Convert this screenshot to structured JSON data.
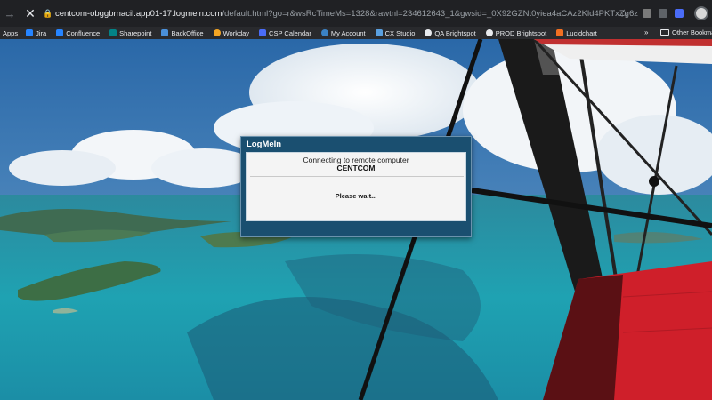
{
  "browser": {
    "url_host": "centcom-obggbrnacil.app01-17.logmein.com",
    "url_path": "/default.html?go=r&wsRcTimeMs=1328&rawtnl=234612643_1&gwsid=_0X92GZNt0yiea4aCAz2Kld4PKTxZg6z",
    "back_icon": "arrow-right-icon",
    "close_icon": "close-icon"
  },
  "bookmarks": {
    "apps_label": "Apps",
    "items": [
      {
        "label": "Jira",
        "color": "#2684ff"
      },
      {
        "label": "Confluence",
        "color": "#2684ff"
      },
      {
        "label": "Sharepoint",
        "color": "#038387"
      },
      {
        "label": "BackOffice",
        "color": "#4a90d9"
      },
      {
        "label": "Workday",
        "color": "#f5a623"
      },
      {
        "label": "CSP Calendar",
        "color": "#4a6cf7"
      },
      {
        "label": "My Account",
        "color": "#3b82c4"
      },
      {
        "label": "CX Studio",
        "color": "#5aa0e0"
      },
      {
        "label": "QA Brightspot",
        "color": "#e8eaed"
      },
      {
        "label": "PROD Brightspot",
        "color": "#e8eaed"
      },
      {
        "label": "Lucidchart",
        "color": "#f26f21"
      }
    ],
    "more_label": "»",
    "other_label": "Other Bookmarks"
  },
  "dialog": {
    "title": "LogMeIn",
    "line1": "Connecting to remote computer",
    "computer_name": "CENTCOM",
    "status": "Please wait..."
  }
}
